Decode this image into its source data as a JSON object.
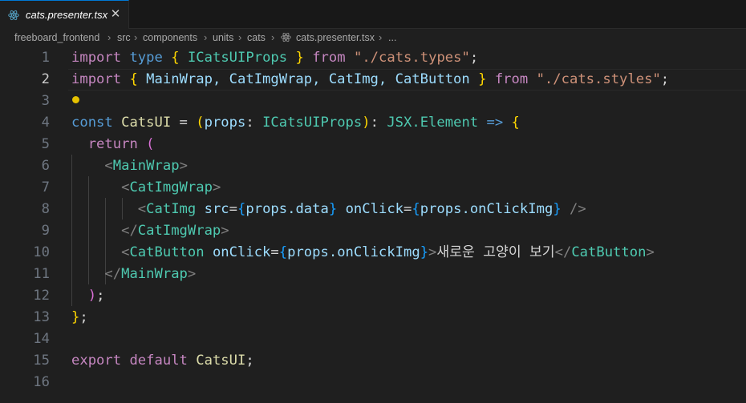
{
  "tab": {
    "filename": "cats.presenter.tsx",
    "close_glyph": "✕"
  },
  "breadcrumb": [
    "freeboard_frontend",
    "src",
    "components",
    "units",
    "cats",
    "cats.presenter.tsx",
    "..."
  ],
  "editor": {
    "active_line": 2,
    "line_numbers": [
      "1",
      "2",
      "3",
      "4",
      "5",
      "6",
      "7",
      "8",
      "9",
      "10",
      "11",
      "12",
      "13",
      "14",
      "15",
      "16"
    ],
    "lines": [
      {
        "import": "import",
        "type": "type",
        "ob": "{",
        "name": "ICatsUIProps",
        "cb": "}",
        "from": "from",
        "path": "\"./cats.types\"",
        "semi": ";"
      },
      {
        "import": "import",
        "ob": "{",
        "names": "MainWrap, CatImgWrap, CatImg, CatButton",
        "cb": "}",
        "from": "from",
        "path": "\"./cats.styles\"",
        "semi": ";"
      },
      {},
      {
        "const": "const",
        "name": "CatsUI",
        "eq": " = ",
        "op": "(",
        "param": "props",
        "colon": ": ",
        "ptype": "ICatsUIProps",
        "cp": ")",
        "colon2": ": ",
        "rtype": "JSX.Element",
        "arrow": " => ",
        "ob": "{"
      },
      {
        "return": "return",
        "op": "("
      },
      {
        "lt": "<",
        "tag": "MainWrap",
        "gt": ">"
      },
      {
        "lt": "<",
        "tag": "CatImgWrap",
        "gt": ">"
      },
      {
        "lt": "<",
        "tag": "CatImg",
        "attr1": "src",
        "eq1": "=",
        "o1": "{",
        "v1": "props.data",
        "c1": "}",
        "attr2": "onClick",
        "eq2": "=",
        "o2": "{",
        "v2": "props.onClickImg",
        "c2": "}",
        "close": " />"
      },
      {
        "lt": "</",
        "tag": "CatImgWrap",
        "gt": ">"
      },
      {
        "lt": "<",
        "tag": "CatButton",
        "attr": "onClick",
        "eq": "=",
        "o": "{",
        "v": "props.onClickImg",
        "c": "}",
        "gt": ">",
        "text": "새로운 고양이 보기",
        "lt2": "</",
        "tag2": "CatButton",
        "gt2": ">"
      },
      {
        "lt": "</",
        "tag": "MainWrap",
        "gt": ">"
      },
      {
        "cp": ")",
        "semi": ";"
      },
      {
        "cb": "}",
        "semi": ";"
      },
      {},
      {
        "export": "export",
        "default": "default",
        "name": "CatsUI",
        "semi": ";"
      },
      {}
    ]
  },
  "colors": {
    "keyword": "#569cd6",
    "control": "#c586c0",
    "type": "#4ec9b0",
    "variable": "#9cdcfe",
    "string": "#ce9178",
    "bracket1": "#ffd700",
    "bracket2": "#da70d6",
    "bracket3": "#179fff"
  },
  "icons": {
    "file": "react-icon",
    "close": "close-icon",
    "chevron": "chevron-right-icon",
    "lightbulb": "lightbulb-icon"
  }
}
